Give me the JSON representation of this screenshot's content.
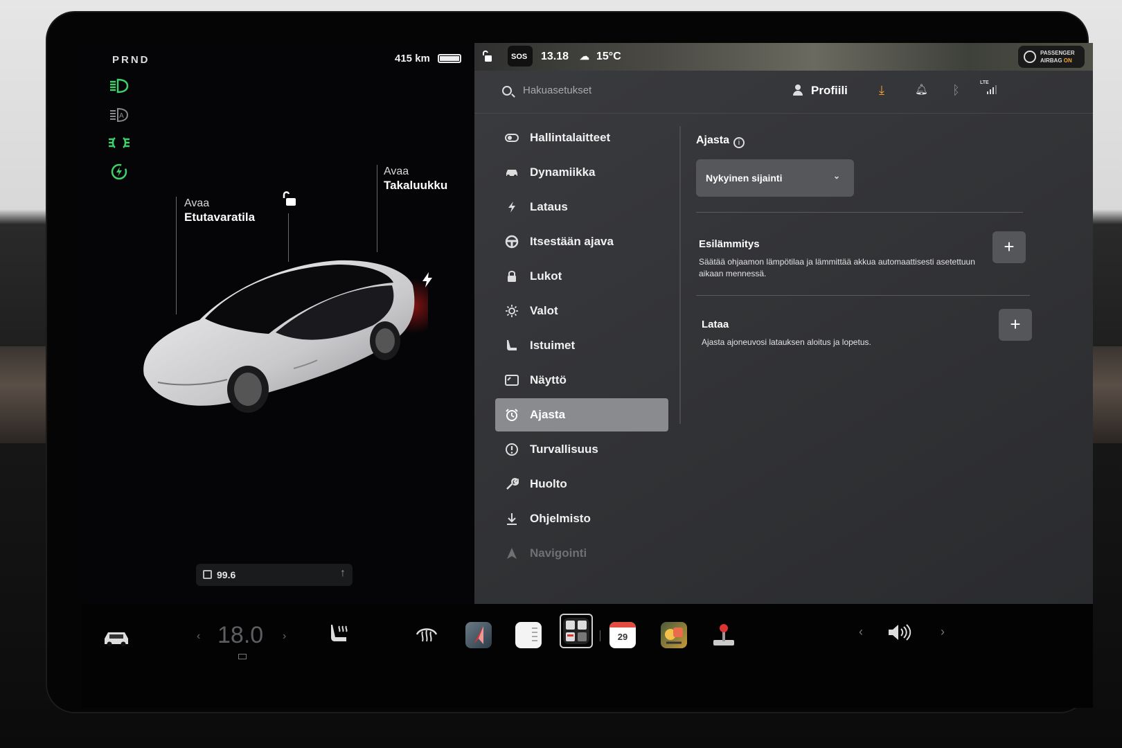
{
  "left": {
    "gear": "PRND",
    "range": "415 km",
    "frunk": {
      "line1": "Avaa",
      "line2": "Etutavaratila"
    },
    "trunk": {
      "line1": "Avaa",
      "line2": "Takaluukku"
    },
    "odometer": "99.6"
  },
  "statusbar": {
    "sos": "SOS",
    "time": "13.18",
    "temperature": "15°C",
    "airbag_line1": "PASSENGER",
    "airbag_line2_a": "AIRBAG",
    "airbag_line2_b": "ON"
  },
  "topbar": {
    "search_placeholder": "Hakuasetukset",
    "profile_label": "Profiili",
    "lte": "LTE"
  },
  "menu": {
    "items": [
      {
        "label": "Hallintalaitteet",
        "icon": "toggle-icon"
      },
      {
        "label": "Dynamiikka",
        "icon": "car-icon"
      },
      {
        "label": "Lataus",
        "icon": "bolt-icon"
      },
      {
        "label": "Itsestään ajava",
        "icon": "steering-wheel-icon"
      },
      {
        "label": "Lukot",
        "icon": "lock-icon"
      },
      {
        "label": "Valot",
        "icon": "sun-icon"
      },
      {
        "label": "Istuimet",
        "icon": "seat-icon"
      },
      {
        "label": "Näyttö",
        "icon": "display-icon"
      },
      {
        "label": "Ajasta",
        "icon": "alarm-clock-icon",
        "active": true
      },
      {
        "label": "Turvallisuus",
        "icon": "alert-circle-icon"
      },
      {
        "label": "Huolto",
        "icon": "wrench-icon"
      },
      {
        "label": "Ohjelmisto",
        "icon": "download-icon"
      },
      {
        "label": "Navigointi",
        "icon": "navigation-icon"
      }
    ]
  },
  "content": {
    "title": "Ajasta",
    "location_select": "Nykyinen sijainti",
    "preheat": {
      "title": "Esilämmitys",
      "desc": "Säätää ohjaamon lämpötilaa ja lämmittää akkua automaattisesti asetettuun aikaan mennessä."
    },
    "charge": {
      "title": "Lataa",
      "desc": "Ajasta ajoneuvosi latauksen aloitus ja lopetus."
    }
  },
  "dock": {
    "temperature": "18.0",
    "calendar_day": "29"
  },
  "colors": {
    "accent_orange": "#f2a33a",
    "indicator_green": "#3fd16a",
    "active_menu": "#8a8b8f"
  }
}
